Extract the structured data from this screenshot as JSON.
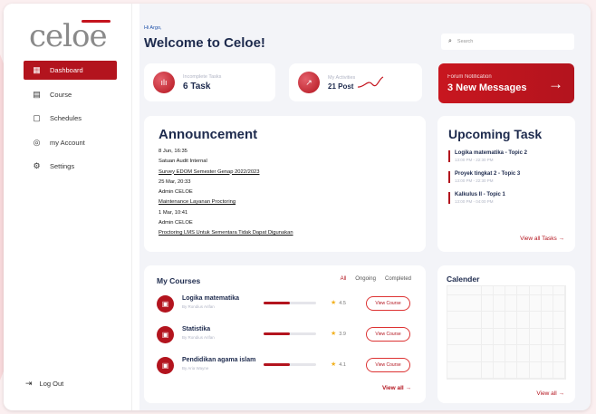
{
  "app": {
    "logo_text": "celoe"
  },
  "sidebar": {
    "items": [
      {
        "label": "Dashboard",
        "icon": "grid-icon"
      },
      {
        "label": "Course",
        "icon": "book-icon"
      },
      {
        "label": "Schedules",
        "icon": "calendar-icon"
      },
      {
        "label": "my Account",
        "icon": "account-icon"
      },
      {
        "label": "Settings",
        "icon": "gear-icon"
      }
    ],
    "logout": "Log Out"
  },
  "header": {
    "greeting": "Hi Argo,",
    "title": "Welcome to Celoe!",
    "search_placeholder": "Search"
  },
  "stats": {
    "incomplete_label": "Incomplete Tasks",
    "incomplete_value": "6 Task",
    "activities_label": "My Activities",
    "activities_value": "21 Post"
  },
  "forum": {
    "label": "Forum Notification",
    "value": "3 New Messages",
    "arrow": "→"
  },
  "announcement": {
    "title": "Announcement",
    "lines": [
      {
        "text": "8 Jun, 16:35",
        "link": false
      },
      {
        "text": "Satuan Audit Internal",
        "link": false
      },
      {
        "text": "Survey EDOM Semester Genap 2022/2023",
        "link": true
      },
      {
        "text": "25 Mar, 20:33",
        "link": false
      },
      {
        "text": "Admin CELOE",
        "link": false
      },
      {
        "text": "Maintenance Layanan Proctoring",
        "link": true
      },
      {
        "text": "1 Mar, 10:41",
        "link": false
      },
      {
        "text": "Admin CELOE",
        "link": false
      },
      {
        "text": "Proctoring LMS Untuk Sementara Tidak Dapat Digunakan",
        "link": true
      }
    ]
  },
  "upcoming": {
    "title": "Upcoming Task",
    "tasks": [
      {
        "title": "Logika matematika - Topic 2",
        "time": "13:00 PM - 22:30 PM"
      },
      {
        "title": "Proyek tingkat 2 - Topic 3",
        "time": "13:00 PM - 22:30 PM"
      },
      {
        "title": "Kalkulus II - Topic 1",
        "time": "13:00 PM - 04:00 PM"
      }
    ],
    "view_all": "View all Tasks →"
  },
  "courses": {
    "title": "My Courses",
    "tabs": [
      "All",
      "Ongoing",
      "Completed"
    ],
    "items": [
      {
        "title": "Logika matematika",
        "by": "By Rondius Arifan",
        "progress": 0.5,
        "rating": "4.5",
        "button": "View Course"
      },
      {
        "title": "Statistika",
        "by": "By Rondius Arifan",
        "progress": 0.5,
        "rating": "3.9",
        "button": "View Course"
      },
      {
        "title": "Pendidikan agama islam",
        "by": "By Aria Wayne",
        "progress": 0.5,
        "rating": "4.1",
        "button": "View Course"
      }
    ],
    "view_all": "View all →"
  },
  "calendar": {
    "title": "Calender",
    "view_all": "View all →"
  },
  "colors": {
    "accent": "#b3141e",
    "navy": "#1d2a4d"
  }
}
